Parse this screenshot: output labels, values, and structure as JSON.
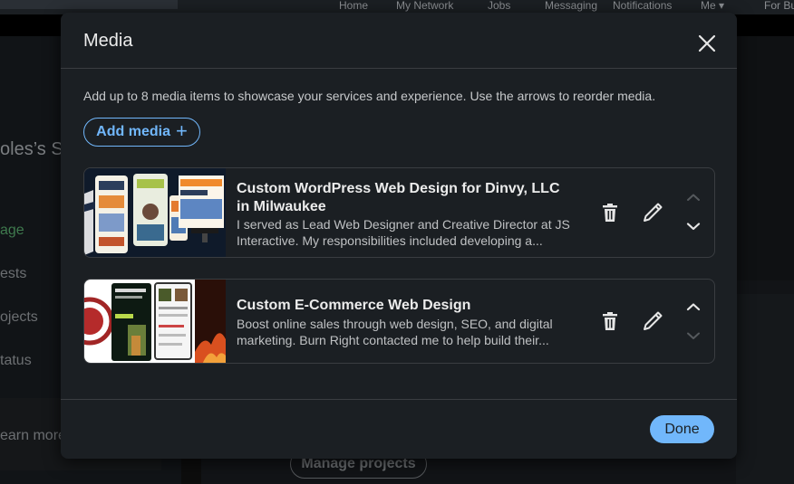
{
  "background": {
    "nav": [
      "Home",
      "My Network",
      "Jobs",
      "Messaging",
      "Notifications",
      "Me",
      "For Bu"
    ],
    "left_fragments": [
      "oles’s Se",
      "age",
      "ests",
      "ojects",
      "tatus",
      "earn more"
    ],
    "manage_projects": "Manage projects"
  },
  "modal": {
    "title": "Media",
    "description": "Add up to 8 media items to showcase your services and experience. Use the arrows to reorder media.",
    "add_media_label": "Add media",
    "items": [
      {
        "title": "Custom WordPress Web Design for Dinvy, LLC in Milwaukee",
        "description": "I served as Lead Web Designer and Creative Director at JS Interactive. My responsibilities included developing a..."
      },
      {
        "title": "Custom E-Commerce Web Design",
        "description": "Boost online sales through web design, SEO, and digital marketing. Burn Right contacted me to help build their..."
      }
    ],
    "done_label": "Done"
  },
  "icons": {
    "close": "close-icon",
    "delete": "trash-icon",
    "edit": "pencil-icon",
    "up": "chevron-up-icon",
    "down": "chevron-down-icon"
  },
  "colors": {
    "accent": "#71b7fb",
    "modal_bg": "#1b1f23",
    "border": "#3a3d41"
  }
}
